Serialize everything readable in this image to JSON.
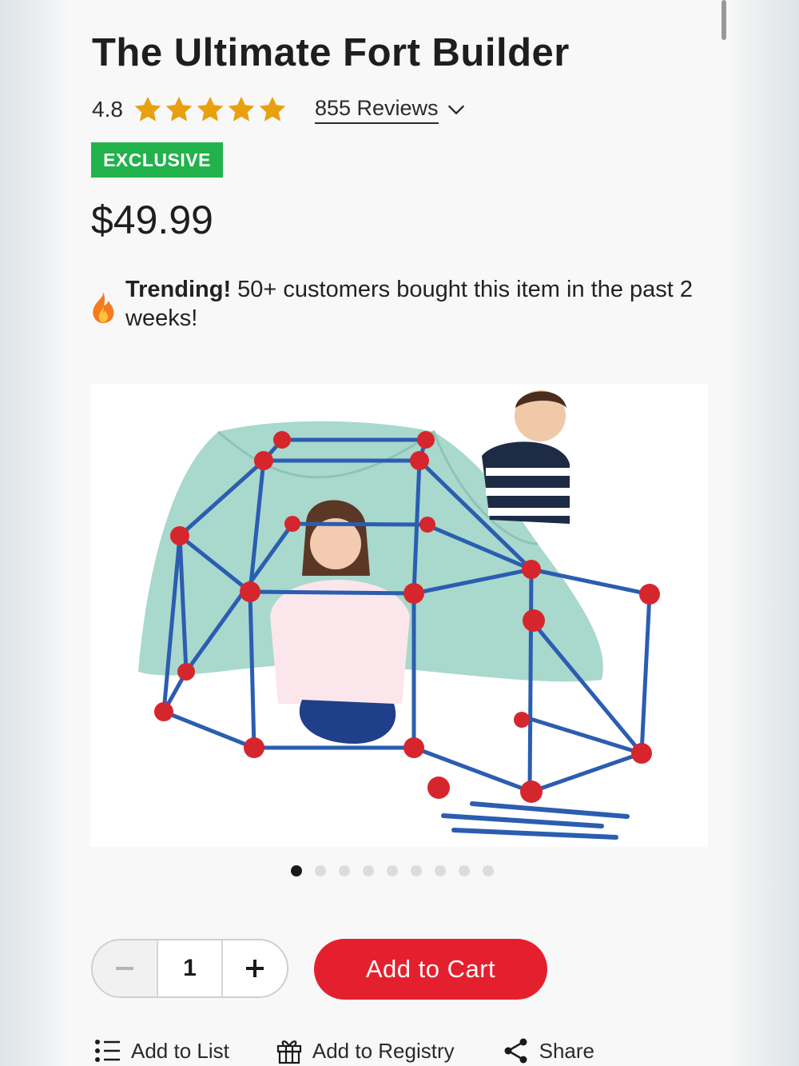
{
  "product": {
    "title": "The Ultimate Fort Builder",
    "rating": "4.8",
    "stars": 5,
    "star_color": "#e8a00f",
    "reviews_label": "855 Reviews",
    "badge": "EXCLUSIVE",
    "badge_color": "#22b24c",
    "price": "$49.99"
  },
  "trending": {
    "icon": "fire-icon",
    "headline": "Trending!",
    "message": " 50+ customers bought this item in the past 2 weeks!"
  },
  "gallery": {
    "image_alt": "Children playing in a fort built from blue rods and red connectors",
    "image_count": 9,
    "active_index": 0
  },
  "purchase": {
    "quantity": "1",
    "add_to_cart_label": "Add to Cart",
    "cart_color": "#e5202e"
  },
  "actions": {
    "add_to_list": "Add to List",
    "add_to_registry": "Add to Registry",
    "share": "Share"
  }
}
